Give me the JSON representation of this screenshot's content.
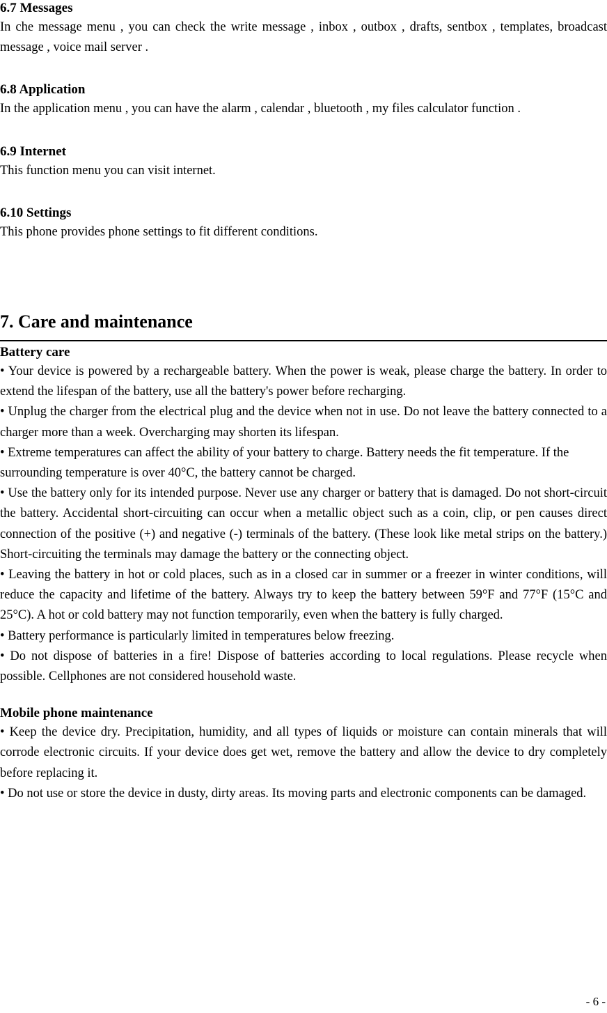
{
  "document": {
    "page_number_label": "- 6 -",
    "sections": [
      {
        "id": "messages",
        "heading": "6.7 Messages",
        "paragraphs": [
          "In che message menu , you can check the write message , inbox , outbox , drafts, sentbox , templates, broadcast message , voice mail server ."
        ]
      },
      {
        "id": "application",
        "heading": "6.8 Application",
        "paragraphs": [
          "In the application menu , you can have the alarm , calendar , bluetooth , my files calculator function ."
        ]
      },
      {
        "id": "internet",
        "heading": "6.9 Internet",
        "paragraphs": [
          "This function menu you can visit internet."
        ]
      },
      {
        "id": "settings",
        "heading": "6.10 Settings",
        "paragraphs": [
          "This phone provides phone settings to fit different conditions."
        ]
      }
    ],
    "chapter": {
      "id": "care-and-maintenance",
      "heading": "7. Care and maintenance",
      "subsections": [
        {
          "id": "battery-care",
          "heading": "Battery care",
          "items": [
            "• Your device is powered by a rechargeable battery. When the power is weak, please charge the battery. In order to extend the lifespan of the battery, use all the battery's power before recharging.",
            "• Unplug the charger from the electrical plug and the device when not in use. Do not leave the battery connected to a charger more than a week. Overcharging may shorten its lifespan.",
            "• Extreme temperatures can affect the ability of your battery to charge. Battery needs the fit temperature. If the surrounding temperature is over 40°C, the battery cannot be charged.",
            "• Use the battery only for its intended purpose. Never use any charger or battery that is damaged. Do not short-circuit the battery. Accidental short-circuiting can occur when a metallic object such as a coin, clip, or pen causes direct connection of the positive (+) and negative (-) terminals of the battery. (These look like metal strips on the battery.) Short-circuiting the terminals may damage the battery or the connecting object.",
            "• Leaving the battery in hot or cold places, such as in a closed car in summer or a freezer in winter conditions, will reduce the capacity and lifetime of the battery. Always try to keep the battery between 59°F and 77°F (15°C and 25°C). A hot or cold battery may not function temporarily, even when the battery is fully charged.",
            "• Battery performance is particularly limited in temperatures below freezing.",
            "• Do not dispose of batteries in a fire! Dispose of batteries according to local regulations. Please recycle when possible. Cellphones are not considered household waste."
          ]
        },
        {
          "id": "mobile-phone-maintenance",
          "heading": "Mobile phone maintenance",
          "items": [
            "• Keep the device dry. Precipitation, humidity, and all types of liquids or moisture can contain minerals that will corrode electronic circuits. If your device does get wet, remove the battery and allow the device to dry completely before replacing it.",
            "• Do not use or store the device in dusty, dirty areas. Its moving parts and electronic components can be damaged."
          ]
        }
      ]
    }
  }
}
